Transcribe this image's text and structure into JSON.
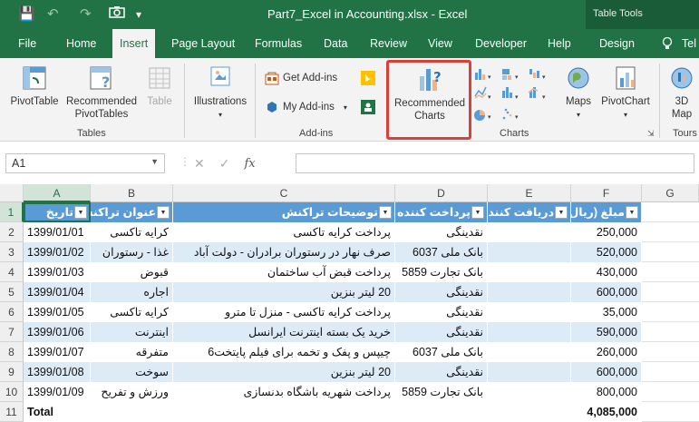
{
  "titlebar": {
    "title": "Part7_Excel in Accounting.xlsx  -  Excel",
    "context_label": "Table Tools",
    "qa_save": "💾",
    "qa_undo": "↶",
    "qa_redo": "↷",
    "qa_custom": "▾"
  },
  "tabs": {
    "file": "File",
    "home": "Home",
    "insert": "Insert",
    "page_layout": "Page Layout",
    "formulas": "Formulas",
    "data": "Data",
    "review": "Review",
    "view": "View",
    "developer": "Developer",
    "help": "Help",
    "design": "Design",
    "tell": "Tel"
  },
  "ribbon": {
    "pivottable": "PivotTable",
    "recommended_pivottables_1": "Recommended",
    "recommended_pivottables_2": "PivotTables",
    "table": "Table",
    "tables_group": "Tables",
    "illustrations": "Illustrations",
    "get_addins": "Get Add-ins",
    "my_addins": "My Add-ins",
    "addins_group": "Add-ins",
    "recommended_charts_1": "Recommended",
    "recommended_charts_2": "Charts",
    "maps": "Maps",
    "pivotchart": "PivotChart",
    "charts_group": "Charts",
    "threed_map_1": "3D",
    "threed_map_2": "Map",
    "tours_group": "Tours"
  },
  "formula_bar": {
    "name_box": "A1",
    "fx": "fx",
    "cancel": "✕",
    "enter": "✓"
  },
  "columns": [
    "A",
    "B",
    "C",
    "D",
    "E",
    "F",
    "G"
  ],
  "row_numbers": [
    "1",
    "2",
    "3",
    "4",
    "5",
    "6",
    "7",
    "8",
    "9",
    "10",
    "11"
  ],
  "table_headers": [
    "تاریخ",
    "عنوان تراکنش",
    "توضیحات تراکنش",
    "پرداخت کننده",
    "دریافت کننده",
    "مبلغ (ریال)"
  ],
  "rows": [
    {
      "date": "1399/01/01",
      "title": "کرایه تاکسی",
      "desc": "پرداخت کرایه تاکسی",
      "payer": "نقدینگی",
      "receiver": "",
      "amount": "250,000"
    },
    {
      "date": "1399/01/02",
      "title": "غذا - رستوران",
      "desc": "صرف نهار در رستوران برادران - دولت آباد",
      "payer": "بانک ملی 6037",
      "receiver": "",
      "amount": "520,000"
    },
    {
      "date": "1399/01/03",
      "title": "قبوض",
      "desc": "پرداخت قبض آب ساختمان",
      "payer": "بانک تجارت 5859",
      "receiver": "",
      "amount": "430,000"
    },
    {
      "date": "1399/01/04",
      "title": "اجاره",
      "desc": "20 لیتر بنزین",
      "payer": "نقدینگی",
      "receiver": "",
      "amount": "600,000"
    },
    {
      "date": "1399/01/05",
      "title": "کرایه تاکسی",
      "desc": "پرداخت کرایه تاکسی - منزل تا مترو",
      "payer": "نقدینگی",
      "receiver": "",
      "amount": "35,000"
    },
    {
      "date": "1399/01/06",
      "title": "اینترنت",
      "desc": "خرید یک بسته اینترنت ایرانسل",
      "payer": "نقدینگی",
      "receiver": "",
      "amount": "590,000"
    },
    {
      "date": "1399/01/07",
      "title": "متفرقه",
      "desc": "چیپس و پفک و تخمه برای فیلم پایتخت6",
      "payer": "بانک ملی 6037",
      "receiver": "",
      "amount": "260,000"
    },
    {
      "date": "1399/01/08",
      "title": "سوخت",
      "desc": "20 لیتر بنزین",
      "payer": "نقدینگی",
      "receiver": "",
      "amount": "600,000"
    },
    {
      "date": "1399/01/09",
      "title": "ورزش و تفریح",
      "desc": "پرداخت شهریه باشگاه بدنسازی",
      "payer": "بانک تجارت 5859",
      "receiver": "",
      "amount": "800,000"
    }
  ],
  "total": {
    "label": "Total",
    "amount": "4,085,000"
  },
  "colors": {
    "excel_green": "#217346",
    "table_header": "#5b9bd5",
    "band": "#ddebf7",
    "highlight": "#d9403a"
  }
}
